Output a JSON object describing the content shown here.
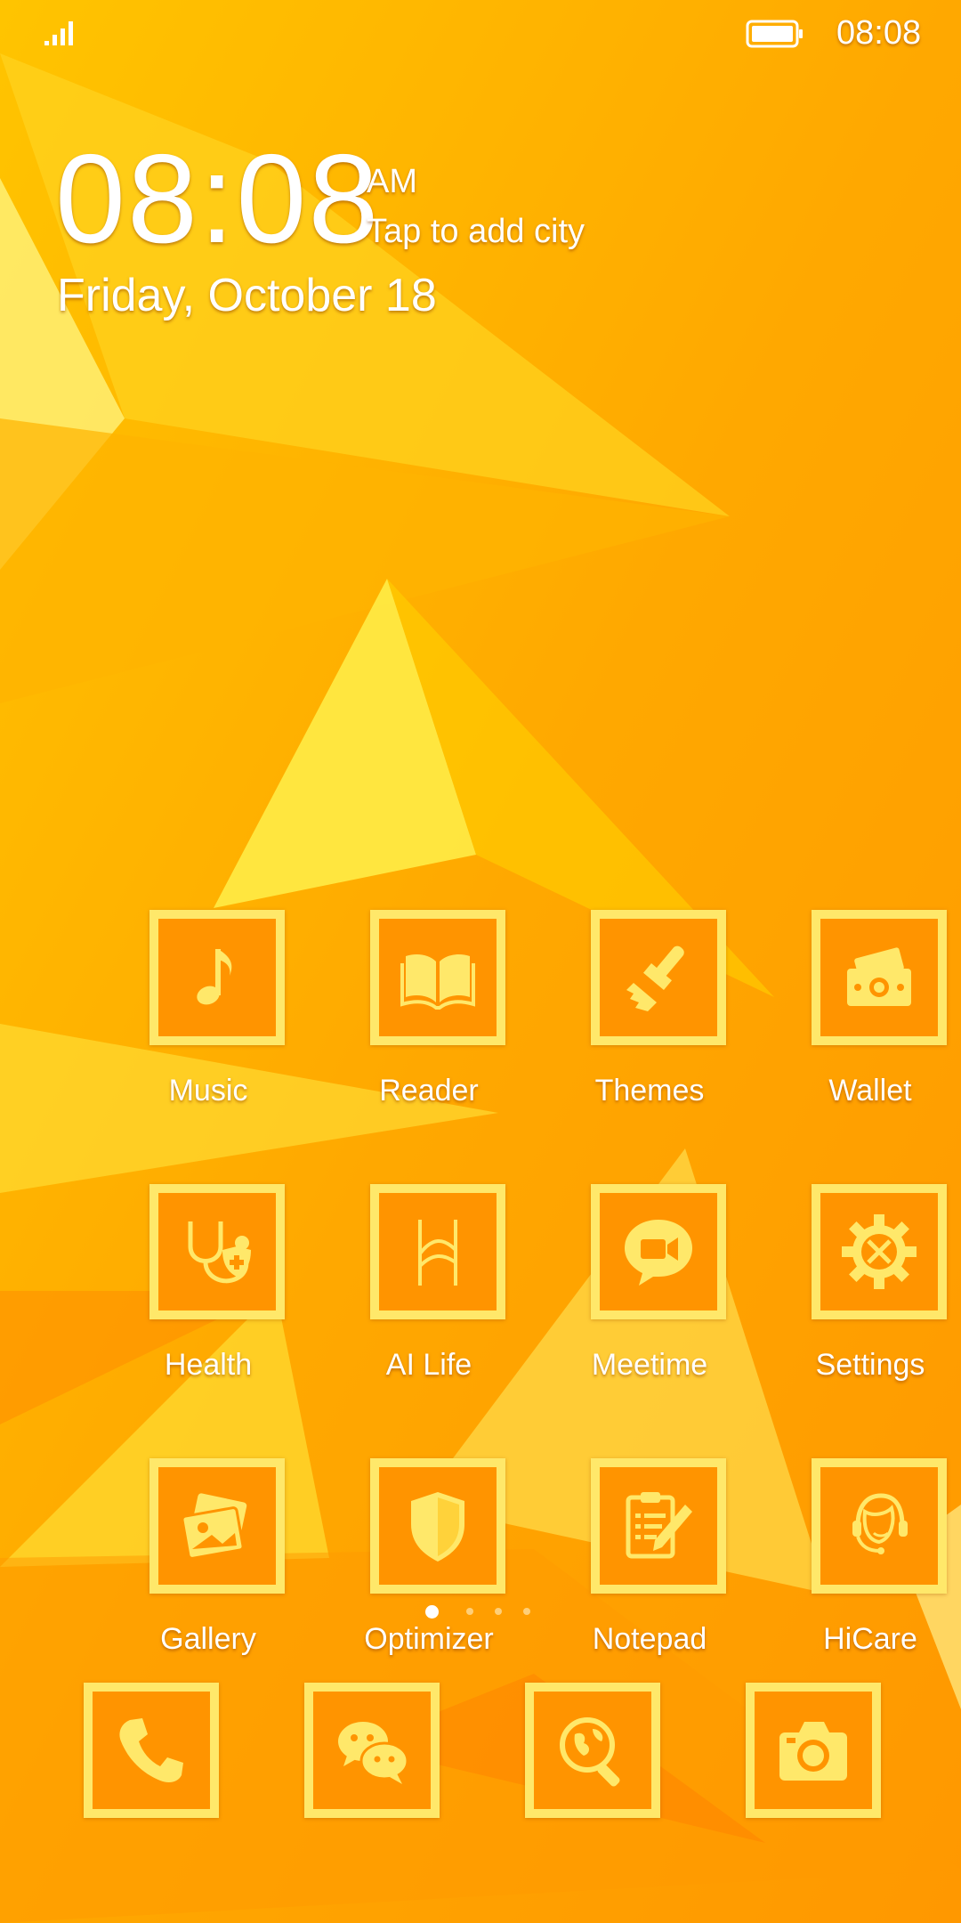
{
  "status_bar": {
    "time": "08:08",
    "signal_icon": "signal-icon",
    "battery_icon": "battery-icon"
  },
  "clock_widget": {
    "time": "08:08",
    "ampm": "AM",
    "city": "Tap to add city",
    "date": "Friday, October 18"
  },
  "apps": [
    {
      "label": "Music",
      "icon": "music-note-icon"
    },
    {
      "label": "Reader",
      "icon": "open-book-icon"
    },
    {
      "label": "Themes",
      "icon": "paintbrush-icon"
    },
    {
      "label": "Wallet",
      "icon": "wallet-cash-icon"
    },
    {
      "label": "Health",
      "icon": "stethoscope-icon"
    },
    {
      "label": "AI Life",
      "icon": "ai-life-icon"
    },
    {
      "label": "Meetime",
      "icon": "video-chat-icon"
    },
    {
      "label": "Settings",
      "icon": "gear-tools-icon"
    },
    {
      "label": "Gallery",
      "icon": "photos-icon"
    },
    {
      "label": "Optimizer",
      "icon": "shield-icon"
    },
    {
      "label": "Notepad",
      "icon": "clipboard-pencil-icon"
    },
    {
      "label": "HiCare",
      "icon": "headset-support-icon"
    }
  ],
  "page_indicator": {
    "pages": 4,
    "current": 1
  },
  "dock": [
    {
      "icon": "phone-icon"
    },
    {
      "icon": "wechat-icon"
    },
    {
      "icon": "browser-globe-icon"
    },
    {
      "icon": "camera-icon"
    }
  ],
  "colors": {
    "tile_border": "#ffe86a",
    "tile_fill": "#ff9400",
    "icon_fill": "#ffe86a",
    "wallpaper_base": "#ffae00"
  }
}
